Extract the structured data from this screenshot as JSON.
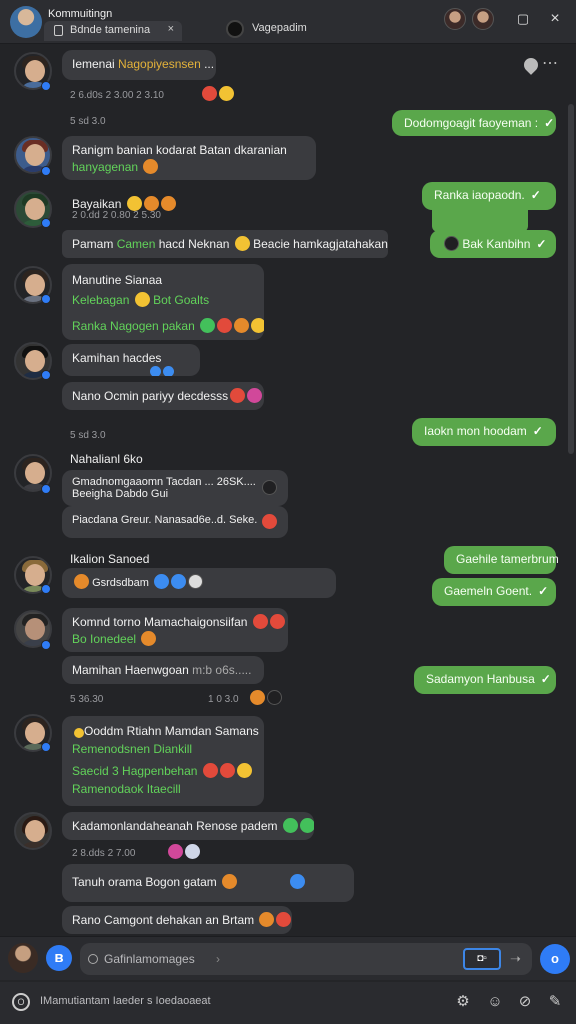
{
  "window": {
    "title": "Kommuitingn",
    "tab1_label": "Bdnde tamenina",
    "tab1_close": "×",
    "tab2_label": "Vagepadim",
    "min_label": "▢",
    "close_label": "×"
  },
  "messages": {
    "m1": {
      "text_a": "Iemenai ",
      "text_b": "Nagopiyesnsen",
      "text_c": " ..."
    },
    "m1_meta": "2 6.d0s  2 3.00  2 3.10",
    "day1": "5 sd 3.0",
    "out1": "Dodomgoagit faoyeman :",
    "m2_l1": "Ranigm banian kodarat Batan dkaranian",
    "m2_l2": "hanyagenan",
    "m3_name": "Bayaikan",
    "m3_meta": "2 0.dd  2 0.80  2 5.30",
    "out2": "Ranka iaopaodn.",
    "m4_a": "Pamam ",
    "m4_b": "Camen ",
    "m4_c": "hacd Neknan ",
    "m4_d": " Beacie hamkagjatahakanan.",
    "out3": "Bak Kanbihn",
    "m5_l1": "Manutine Sianaa",
    "m5_l2a": "Kelebagan",
    "m5_l2b": "Bot Goalts",
    "m5_l3": "Ranka Nagogen pakan",
    "m6": "Kamihan hacdes",
    "m7": "Nano Ocmin pariyy decdesss",
    "day2": "5 sd 3.0",
    "out4": "Iaokn mon hoodam",
    "m8_name": "Nahalianl 6ko",
    "m8_l1": "Gmadnomgaaomn Tacdan",
    "m8_l1b": "... 26SK....",
    "m8_l2": "Beeigha Dabdo Gui",
    "m8_l3": "Piacdana Greur. Nanasad6e..d. Seke.",
    "m9_name": "Ikalion Sanoed",
    "m9_l1": "Gsrdsdbam",
    "out5": "Gaehile tamerbrum",
    "out6": "Gaemeln Goent.",
    "m10_l1": "Komnd torno Mamachaigonsiifan",
    "m10_l2": "Bo Ionedeel",
    "m11": "Mamihan Haenwgoan",
    "m11_tail": "m:b o6s.....",
    "day3": "5 36.30",
    "day3b": "1 0  3.0",
    "out7": "Sadamyon Hanbusa",
    "m12_l1": "Ooddm Rtiahn Mamdan Samans",
    "m12_l2": "Remenodsnen Diankill",
    "m12_l3": "Saecid 3 Hagpenbehan",
    "m12_l4": "Ramenodaok Itaecill",
    "m13": "Kadamonlandaheanah Renose padem",
    "m13_meta": "2 8.dds  2 7.00",
    "m14": "Tanuh orama  Bogon gatam",
    "m15": "Rano Camgont dehakan an Brtam"
  },
  "composer": {
    "placeholder": "Gafinlamomages",
    "chevron": "›",
    "box_label": "◘▫",
    "send": "➝",
    "attach": "ʙ",
    "mic": "o"
  },
  "footer": {
    "text": "IMamutiantam Iaeder s Ioedaoaeat",
    "o_label": "O"
  },
  "icons": [
    "search-icon",
    "pin-icon",
    "more-icon",
    "gear-icon",
    "emoji-icon",
    "attach-icon",
    "send-icon"
  ],
  "colors": {
    "accent": "#2f7cf6",
    "bubble_out": "#5aa74b",
    "bubble_in": "#3a3b3f",
    "bg": "#232427",
    "link_green": "#62d35a"
  }
}
